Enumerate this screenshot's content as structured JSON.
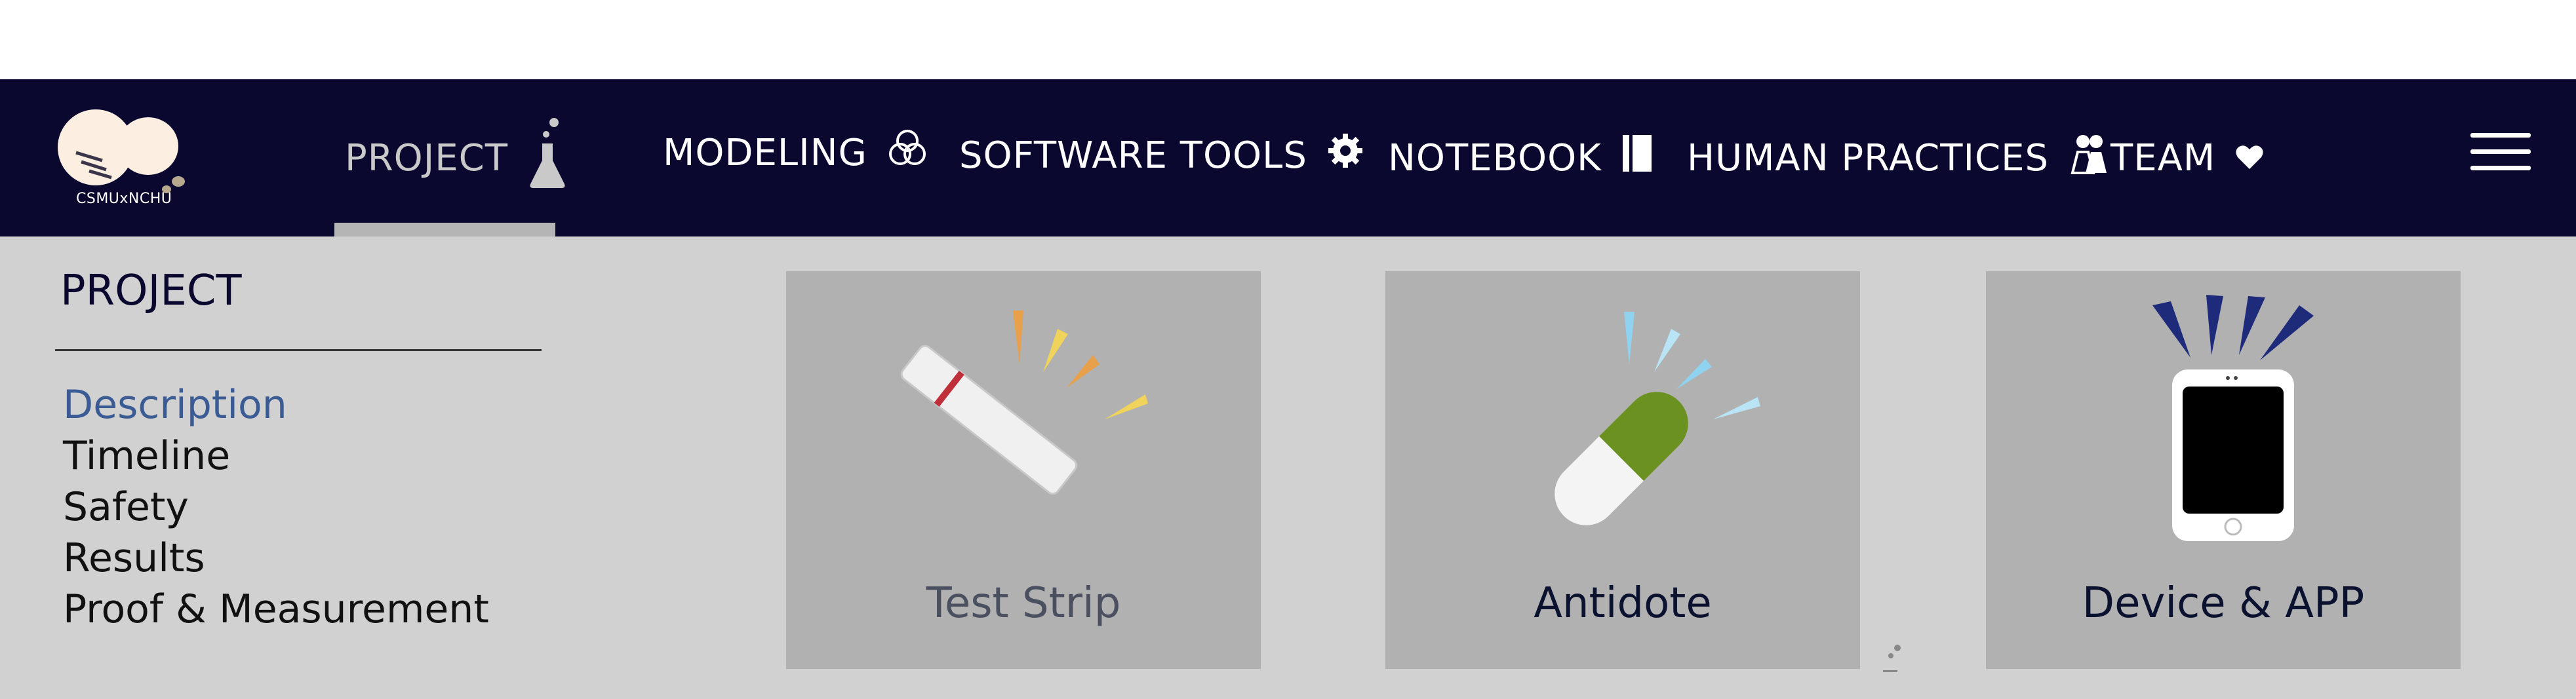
{
  "header": {
    "logo_text": "CSMUxNCHU",
    "nav": [
      {
        "label": "PROJECT",
        "icon": "flask-icon",
        "active": true
      },
      {
        "label": "MODELING",
        "icon": "three-circles-icon"
      },
      {
        "label": "SOFTWARE TOOLS",
        "icon": "gear-icon"
      },
      {
        "label": "NOTEBOOK",
        "icon": "notebook-icon"
      },
      {
        "label": "HUMAN PRACTICES",
        "icon": "people-icon"
      },
      {
        "label": "TEAM",
        "icon": "heart-icon"
      }
    ],
    "menu_icon": "hamburger-icon"
  },
  "dropdown": {
    "title": "PROJECT",
    "items": [
      {
        "label": "Description",
        "current": true
      },
      {
        "label": "Timeline"
      },
      {
        "label": "Safety"
      },
      {
        "label": "Results"
      },
      {
        "label": "Proof & Measurement"
      }
    ],
    "cards": [
      {
        "label": "Test Strip",
        "icon": "test-strip-icon"
      },
      {
        "label": "Antidote",
        "icon": "pill-icon"
      },
      {
        "label": "Device & APP",
        "icon": "phone-icon"
      }
    ]
  },
  "colors": {
    "nav_bg": "#0b0830",
    "dropdown_bg": "#d1d1d1",
    "card_bg": "#b1b1b1",
    "active_link": "#3b5b94"
  }
}
